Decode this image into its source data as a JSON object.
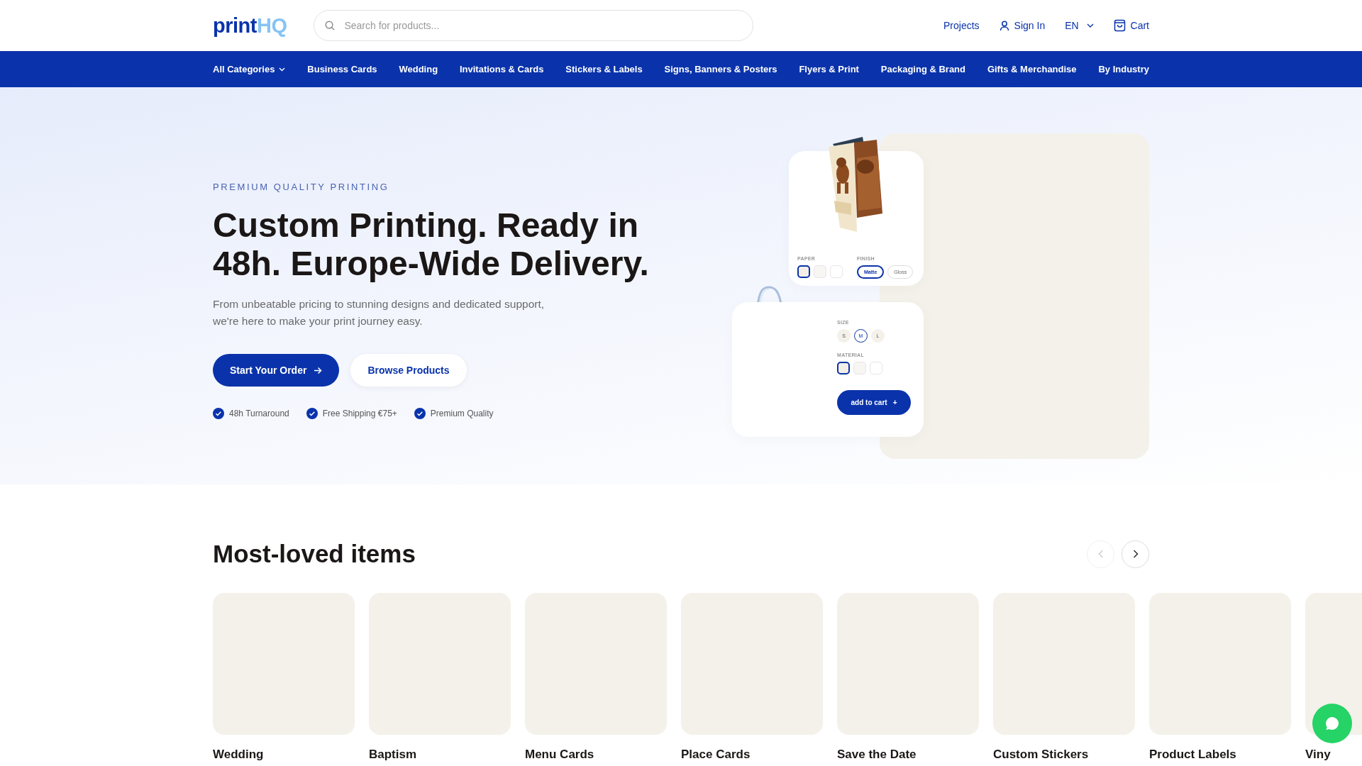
{
  "header": {
    "logo": {
      "part1": "print",
      "part2": "HQ"
    },
    "search": {
      "placeholder": "Search for products..."
    },
    "links": [
      {
        "kind": "link",
        "label": "Projects"
      },
      {
        "kind": "account",
        "label": "Sign In"
      },
      {
        "kind": "language",
        "label": "EN"
      },
      {
        "kind": "cart",
        "label": "Cart"
      }
    ]
  },
  "nav": [
    {
      "kind": "dropdown",
      "label": "All Categories"
    },
    {
      "kind": "link",
      "label": "Business Cards"
    },
    {
      "kind": "link",
      "label": "Wedding"
    },
    {
      "kind": "link",
      "label": "Invitations & Cards"
    },
    {
      "kind": "link",
      "label": "Stickers & Labels"
    },
    {
      "kind": "link",
      "label": "Signs, Banners & Posters"
    },
    {
      "kind": "link",
      "label": "Flyers & Print"
    },
    {
      "kind": "link",
      "label": "Packaging & Brand"
    },
    {
      "kind": "link",
      "label": "Gifts & Merchandise"
    },
    {
      "kind": "link",
      "label": "By Industry"
    }
  ],
  "hero": {
    "eyebrow": "PREMIUM QUALITY PRINTING",
    "title": "Custom Printing. Ready in 48h. Europe-Wide Delivery.",
    "subtitle": "From unbeatable pricing to stunning designs and dedicated support, we're here to make your print journey easy.",
    "buttons": [
      {
        "kind": "primary",
        "label": "Start Your Order"
      },
      {
        "kind": "secondary",
        "label": "Browse Products"
      }
    ],
    "features": [
      "48h Turnaround",
      "Free Shipping €75+",
      "Premium Quality"
    ],
    "brochure_card": {
      "options": [
        {
          "kind": "swatch",
          "label": "PAPER",
          "items": [
            {
              "color": "#f3efe8",
              "selected": true
            },
            {
              "color": "#f7f6f3",
              "selected": false
            },
            {
              "color": "#ffffff",
              "selected": false
            }
          ]
        },
        {
          "kind": "pill",
          "label": "FINISH",
          "items": [
            {
              "label": "Matte",
              "selected": true
            },
            {
              "label": "Gloss",
              "selected": false
            }
          ]
        }
      ]
    },
    "tote_card": {
      "options": [
        {
          "kind": "circle",
          "label": "SIZE",
          "items": [
            {
              "label": "S",
              "selected": false
            },
            {
              "label": "M",
              "selected": true
            },
            {
              "label": "L",
              "selected": false
            }
          ]
        },
        {
          "kind": "swatch",
          "label": "MATERIAL",
          "items": [
            {
              "color": "#f3efe8",
              "selected": true
            },
            {
              "color": "#f7f6f3",
              "selected": false
            },
            {
              "color": "#ffffff",
              "selected": false
            }
          ]
        }
      ],
      "button": {
        "label": "add to cart",
        "icon": "+"
      }
    }
  },
  "most_loved": {
    "title": "Most-loved items",
    "prev": {
      "disabled": true
    },
    "next": {
      "disabled": false
    },
    "items": [
      {
        "title": "Wedding"
      },
      {
        "title": "Baptism"
      },
      {
        "title": "Menu Cards"
      },
      {
        "title": "Place Cards"
      },
      {
        "title": "Save the Date"
      },
      {
        "title": "Custom Stickers"
      },
      {
        "title": "Product Labels"
      },
      {
        "title": "Viny"
      }
    ]
  }
}
